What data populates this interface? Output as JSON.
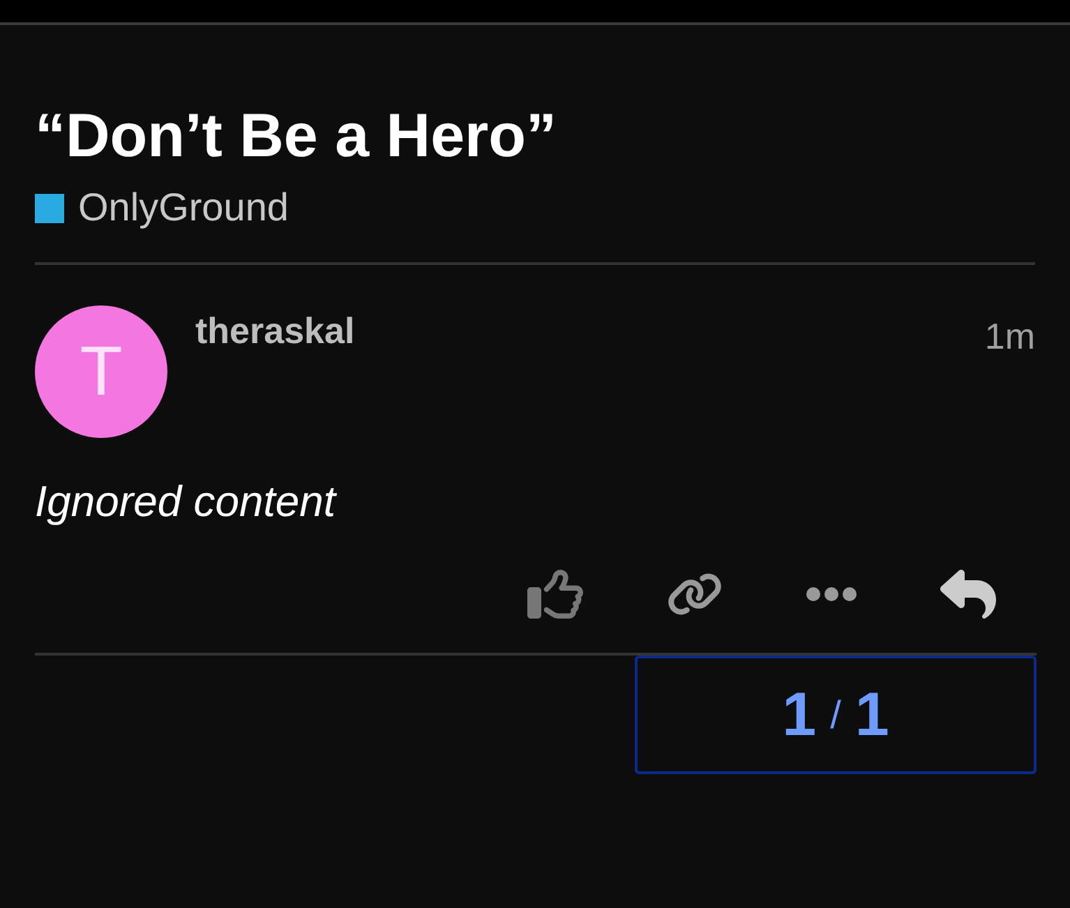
{
  "topic": {
    "title": "“Don’t Be a Hero”"
  },
  "category": {
    "name": "OnlyGround",
    "color": "#29abe2"
  },
  "post": {
    "avatar": {
      "letter": "T",
      "color": "#f476e0"
    },
    "author": "theraskal",
    "time": "1m",
    "content": "Ignored content"
  },
  "progress": {
    "current": "1",
    "separator": "/",
    "total": "1"
  }
}
